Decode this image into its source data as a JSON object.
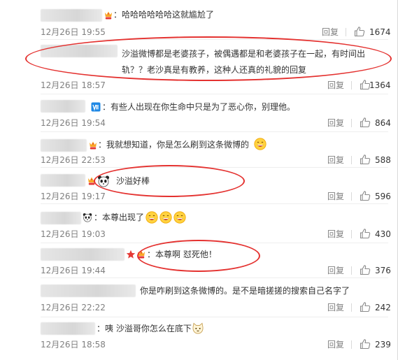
{
  "actions": {
    "reply_label": "回复"
  },
  "colors": {
    "highlight": "#e4312f",
    "text": "#333333",
    "meta": "#808080"
  },
  "comments": [
    {
      "text": "：哈哈哈哈哈哈这就尴尬了",
      "time": "12月26日 19:55",
      "likes": "1674"
    },
    {
      "text": "沙溢微博都是老婆孩子，被偶遇都是和老婆孩子在一起，有时间出轨？？老沙真是有教养，这种人还真的礼貌的回复",
      "time": "12月26日 18:57",
      "likes": "1364"
    },
    {
      "text": "：有些人出现在你生命中只是为了恶心你，别理他。",
      "time": "12月26日 19:54",
      "likes": "864"
    },
    {
      "text": "：我就想知道，你是怎么刷到这条微博的",
      "time": "12月26日 22:53",
      "likes": "588"
    },
    {
      "text": "沙溢好棒",
      "time": "12月26日 19:17",
      "likes": "596"
    },
    {
      "text": "：本尊出现了",
      "time": "12月26日 19:03",
      "likes": "430"
    },
    {
      "text": "：本尊啊 怼死他！",
      "time": "12月26日 19:44",
      "likes": "376"
    },
    {
      "text": "你是咋刷到这条微博的。是不是暗搓搓的搜索自己名字了",
      "time": "12月26日 22:22",
      "likes": "242"
    },
    {
      "text": "：咦 沙溢哥你怎么在底下",
      "time": "12月26日 18:58",
      "likes": "239"
    }
  ],
  "icons": {
    "like": "thumbs-up-icon",
    "vip_badge": "vip-badge-icon",
    "verified_badge": "verified-badge-icon",
    "star": "star-icon",
    "panda_emoji": "panda-icon",
    "grin_emoji": "grinning-face-icon",
    "cat_emoji": "cat-face-icon"
  }
}
